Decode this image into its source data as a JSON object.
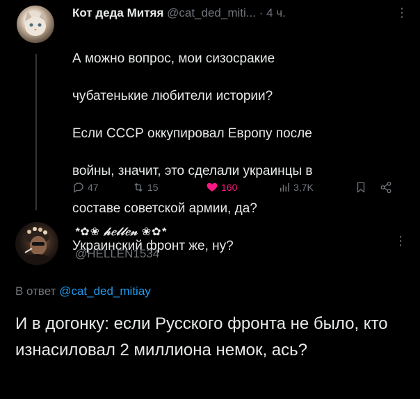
{
  "tweet": {
    "author_name": "Кот деда Митяя",
    "author_handle": "@cat_ded_miti...",
    "separator": "·",
    "time": "4 ч.",
    "text_lines": [
      "А можно вопрос, мои сизосракие",
      "чубатенькие любители истории?",
      "Если СССР оккупировал Европу после",
      "войны, значит, это сделали украинцы в",
      "составе советской армии, да?",
      "Украинский фронт же, ну?"
    ],
    "stats": {
      "replies": "47",
      "retweets": "15",
      "likes": "160",
      "views": "3,7K"
    }
  },
  "reply": {
    "author_name": "*✿❀ 𝒽𝑒𝓁𝓁𝑒𝓃 ❀✿*",
    "author_handle": "@HELLEN1534",
    "reply_to_prefix": "В ответ",
    "reply_to_handle": "@cat_ded_mitiay",
    "text": "И в догонку: если Русского фронта не было, кто изнасиловал 2 миллиона немок, ась?"
  },
  "icons": {
    "reply": "comment-icon",
    "retweet": "retweet-icon",
    "like": "heart-icon",
    "views": "views-icon",
    "bookmark": "bookmark-icon",
    "share": "share-icon",
    "more": "more-vertical-icon"
  },
  "colors": {
    "background": "#000000",
    "text": "#e7e9ea",
    "muted": "#71767b",
    "like": "#f91880",
    "link": "#1d9bf0"
  }
}
